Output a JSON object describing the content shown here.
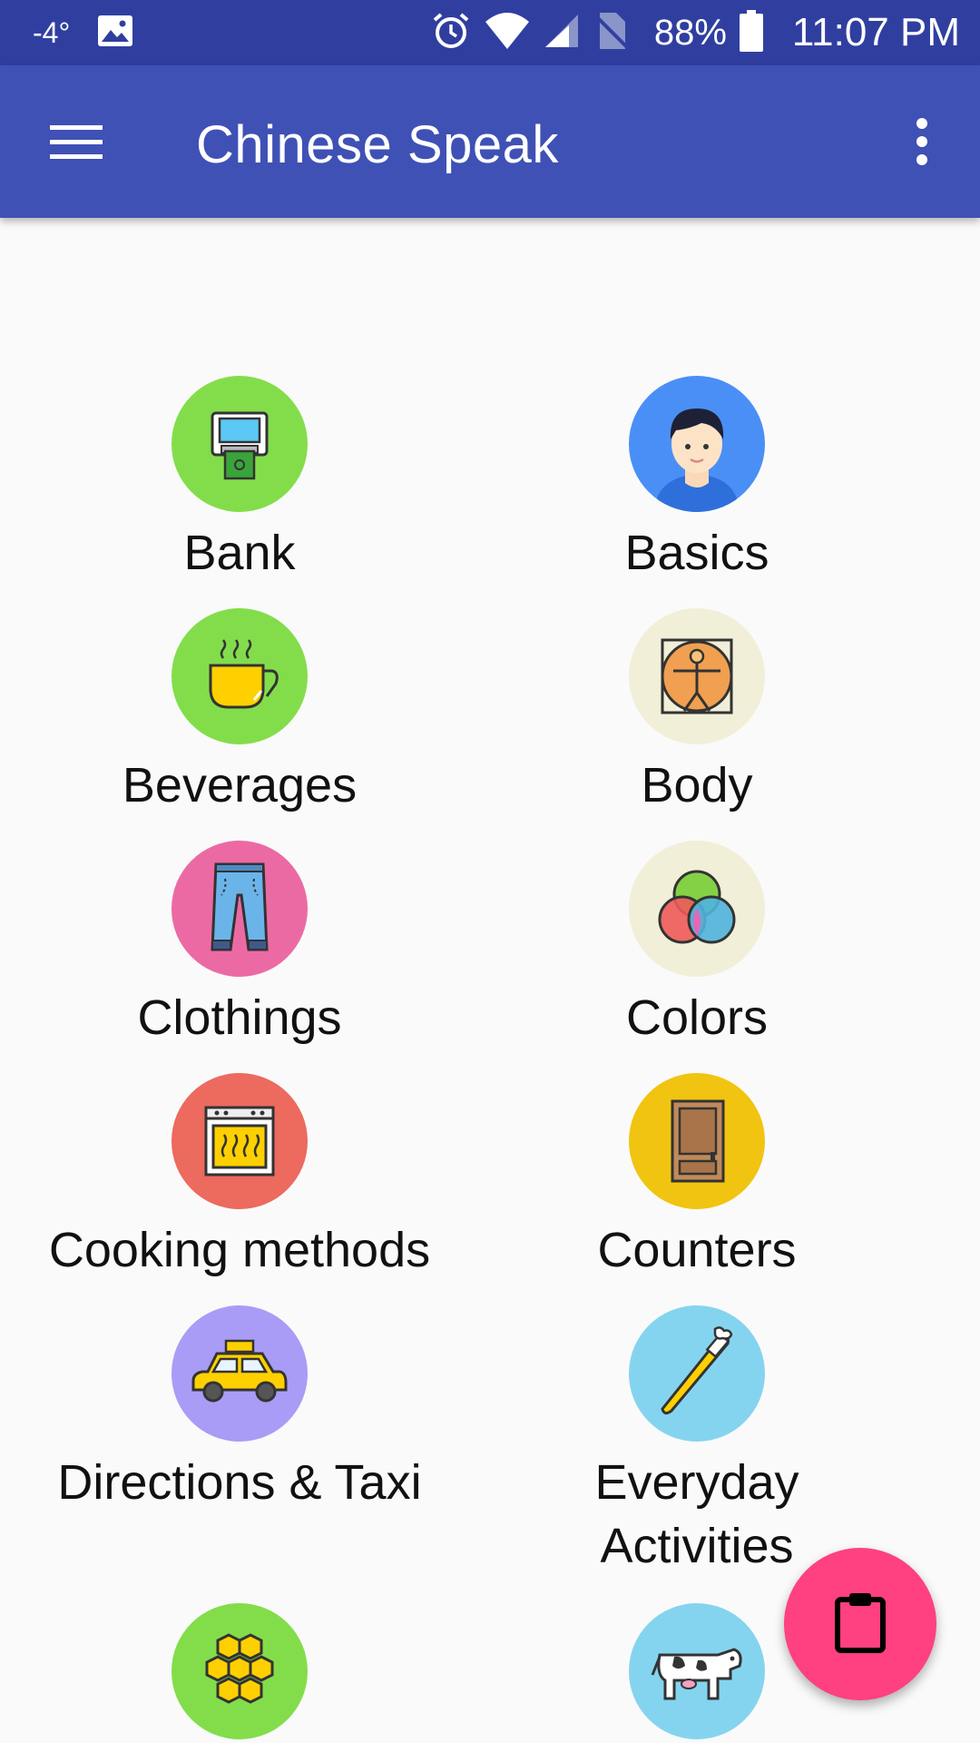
{
  "status_bar": {
    "temperature": "-4°",
    "battery_percent": "88%",
    "time": "11:07 PM",
    "icons": [
      "image-icon",
      "alarm-icon",
      "wifi-icon",
      "signal-icon",
      "no-sim-icon",
      "battery-icon"
    ]
  },
  "app_bar": {
    "title": "Chinese Speak",
    "menu_icon": "hamburger-menu-icon",
    "overflow_icon": "more-vert-icon",
    "color": "#3f51b5",
    "status_color": "#303f9f"
  },
  "categories": [
    {
      "label": "Bank",
      "icon": "atm-icon",
      "color": "#83dd4b"
    },
    {
      "label": "Basics",
      "icon": "person-icon",
      "color": "#4a8ff5"
    },
    {
      "label": "Beverages",
      "icon": "coffee-cup-icon",
      "color": "#83dd4b"
    },
    {
      "label": "Body",
      "icon": "vitruvian-man-icon",
      "color": "#f1efd8"
    },
    {
      "label": "Clothings",
      "icon": "jeans-icon",
      "color": "#ec6aa3"
    },
    {
      "label": "Colors",
      "icon": "color-circles-icon",
      "color": "#f1efd8"
    },
    {
      "label": "Cooking methods",
      "icon": "oven-icon",
      "color": "#ec6a5e"
    },
    {
      "label": "Counters",
      "icon": "door-icon",
      "color": "#f1c411"
    },
    {
      "label": "Directions & Taxi",
      "icon": "taxi-icon",
      "color": "#a99cf6"
    },
    {
      "label": "Everyday\nActivities",
      "icon": "toothbrush-icon",
      "color": "#85d4ef"
    },
    {
      "label": "",
      "icon": "honeycomb-icon",
      "color": "#83dd4b"
    },
    {
      "label": "",
      "icon": "cow-icon",
      "color": "#85d4ef"
    }
  ],
  "fab": {
    "icon": "clipboard-icon",
    "color": "#ff4081"
  }
}
